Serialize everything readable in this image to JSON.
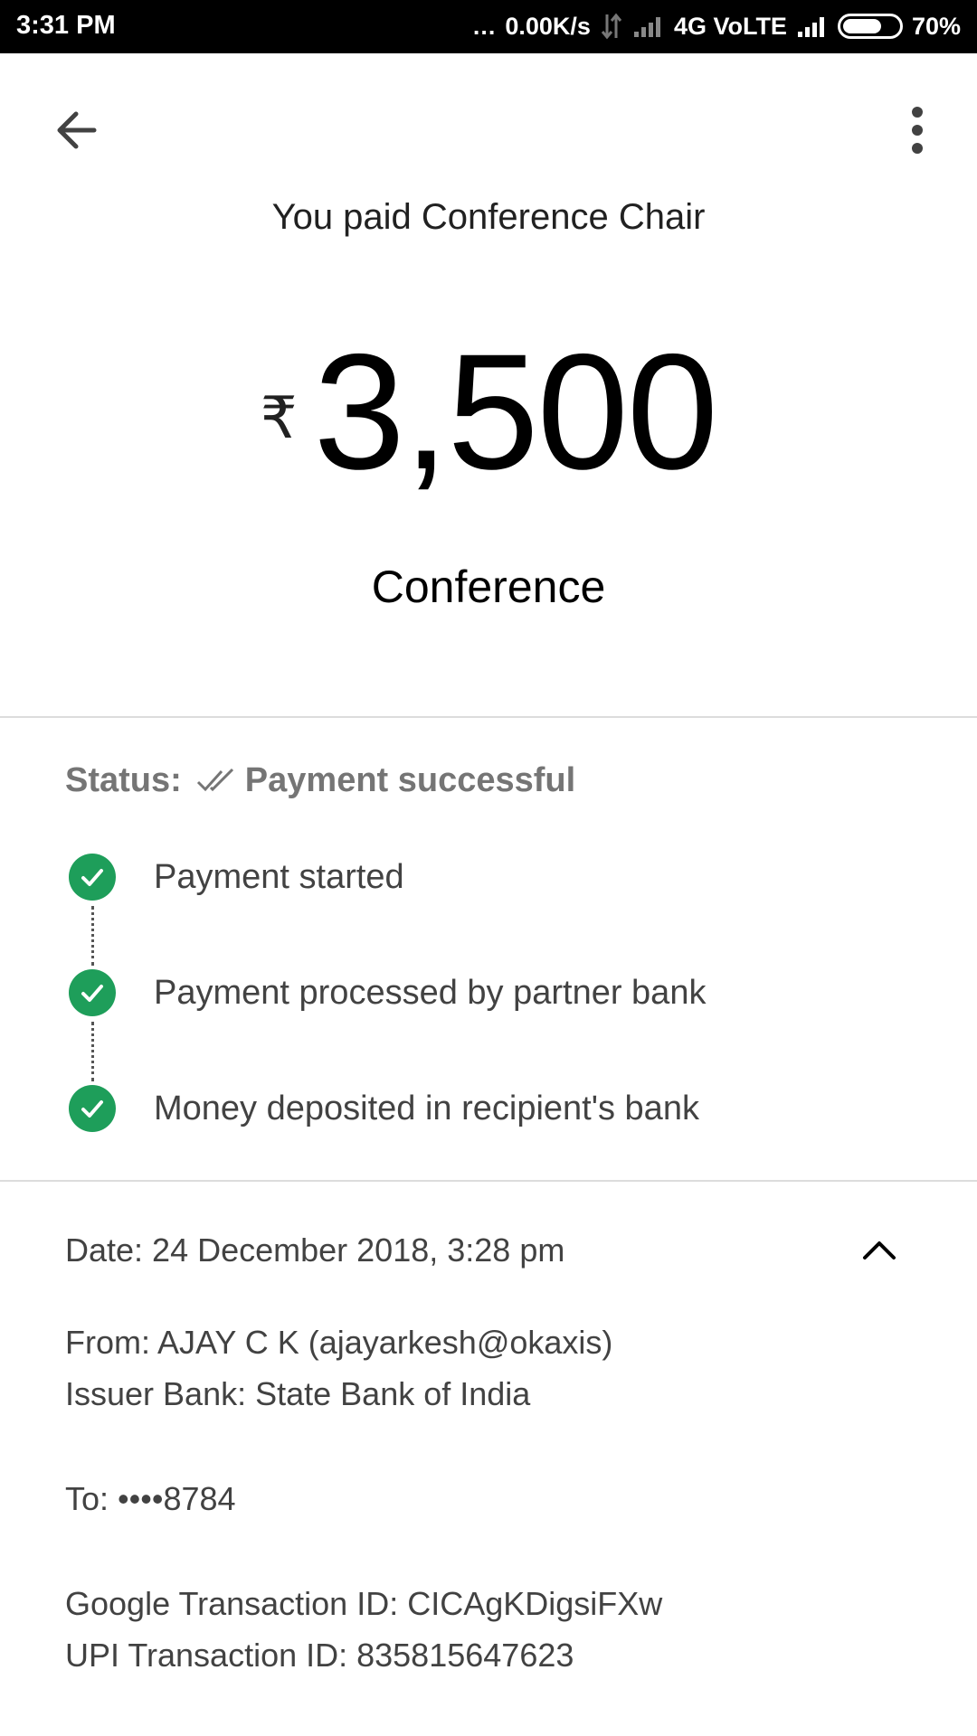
{
  "status_bar": {
    "time": "3:31 PM",
    "dots": "...",
    "net_speed": "0.00K/s",
    "network": "4G VoLTE",
    "battery_text": "70%",
    "battery_level": 0.7
  },
  "header": {
    "back_icon": "arrow-left-icon",
    "more_icon": "more-vertical-icon"
  },
  "payment": {
    "title": "You paid Conference Chair",
    "currency": "₹",
    "amount": "3,500",
    "note": "Conference"
  },
  "status": {
    "label": "Status:",
    "value": "Payment successful",
    "steps": [
      {
        "label": "Payment started"
      },
      {
        "label": "Payment processed by partner bank"
      },
      {
        "label": "Money deposited in recipient's bank"
      }
    ],
    "accent": "#1e9e5a"
  },
  "details": {
    "date": "Date: 24 December 2018, 3:28 pm",
    "from": "From: AJAY  C K (ajayarkesh@okaxis)",
    "issuer_bank": "Issuer Bank: State Bank of India",
    "to": "To: ••••8784",
    "google_txn": "Google Transaction ID: CICAgKDigsiFXw",
    "upi_txn": "UPI Transaction ID: 835815647623",
    "collapse_icon": "chevron-up-icon"
  }
}
